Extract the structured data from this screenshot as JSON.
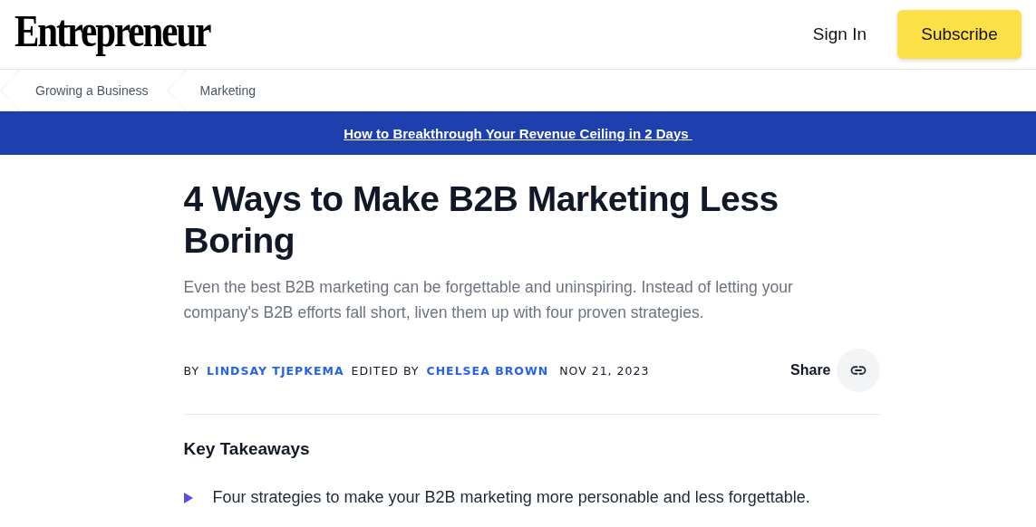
{
  "header": {
    "logo": "Entrepreneur",
    "sign_in": "Sign In",
    "subscribe": "Subscribe"
  },
  "breadcrumbs": [
    "Growing a Business",
    "Marketing"
  ],
  "banner": {
    "link": "How to Breakthrough Your Revenue Ceiling in 2 Days "
  },
  "article": {
    "title": "4 Ways to Make B2B Marketing Less Boring",
    "subtitle": "Even the best B2B marketing can be forgettable and uninspiring. Instead of letting your company's B2B efforts fall short, liven them up with four proven strategies.",
    "byline": [
      {
        "kind": "label",
        "text": "BY"
      },
      {
        "kind": "link",
        "text": "LINDSAY TJEPKEMA"
      },
      {
        "kind": "label",
        "text": "EDITED BY"
      },
      {
        "kind": "link",
        "text": "CHELSEA BROWN"
      },
      {
        "kind": "date",
        "text": "NOV 21, 2023"
      }
    ],
    "share": "Share",
    "takeaways_title": "Key Takeaways",
    "takeaways": [
      "Four strategies to make your B2B marketing more personable and less forgettable."
    ]
  }
}
